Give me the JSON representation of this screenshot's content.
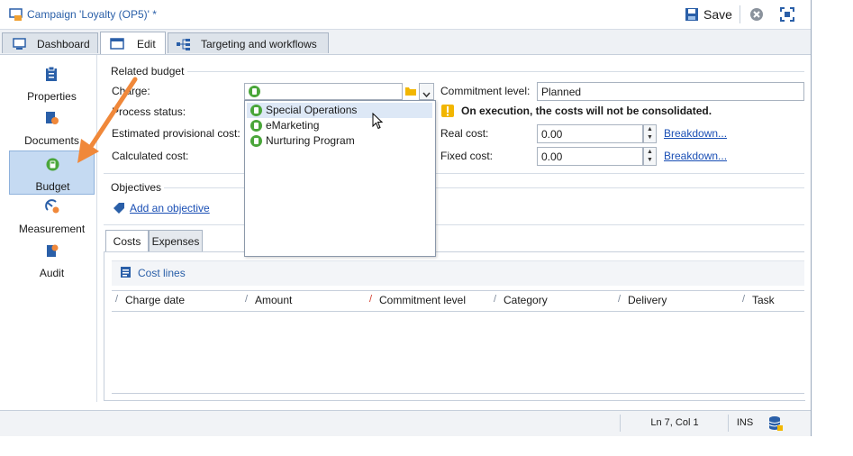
{
  "window": {
    "title": "Campaign 'Loyalty (OP5)' *",
    "save_label": "Save"
  },
  "tabs": [
    {
      "label": "Dashboard"
    },
    {
      "label": "Edit"
    },
    {
      "label": "Targeting and workflows"
    }
  ],
  "sidebar": {
    "items": [
      {
        "label": "Properties",
        "icon": "clipboard-icon"
      },
      {
        "label": "Documents",
        "icon": "documents-icon"
      },
      {
        "label": "Budget",
        "icon": "calculator-icon"
      },
      {
        "label": "Measurement",
        "icon": "measurement-icon"
      },
      {
        "label": "Audit",
        "icon": "audit-icon"
      }
    ]
  },
  "related_budget": {
    "section_label": "Related budget",
    "charge_label": "Charge:",
    "process_status_label": "Process status:",
    "estimated_cost_label": "Estimated provisional cost:",
    "calculated_cost_label": "Calculated cost:",
    "commitment_level_label": "Commitment level:",
    "commitment_level_value": "Planned",
    "warning_text": "On execution, the costs will not be consolidated.",
    "real_cost_label": "Real cost:",
    "real_cost_value": "0.00",
    "fixed_cost_label": "Fixed cost:",
    "fixed_cost_value": "0.00",
    "breakdown_label": "Breakdown..."
  },
  "charge_dropdown": {
    "options": [
      "Special Operations",
      "eMarketing",
      "Nurturing Program"
    ],
    "hovered_index": 0
  },
  "objectives": {
    "section_label": "Objectives",
    "add_label": "Add an objective"
  },
  "bottom_tabs": [
    {
      "label": "Costs"
    },
    {
      "label": "Expenses"
    }
  ],
  "cost_lines": {
    "label": "Cost lines",
    "columns": [
      "Charge date",
      "Amount",
      "Commitment level",
      "Category",
      "Delivery",
      "Task"
    ]
  },
  "status_bar": {
    "position": "Ln 7, Col 1",
    "mode": "INS"
  },
  "colors": {
    "accent": "#2a5fa8",
    "arrow": "#f0883a",
    "budget_icon": "#4aa63a",
    "warning": "#f2b600"
  }
}
